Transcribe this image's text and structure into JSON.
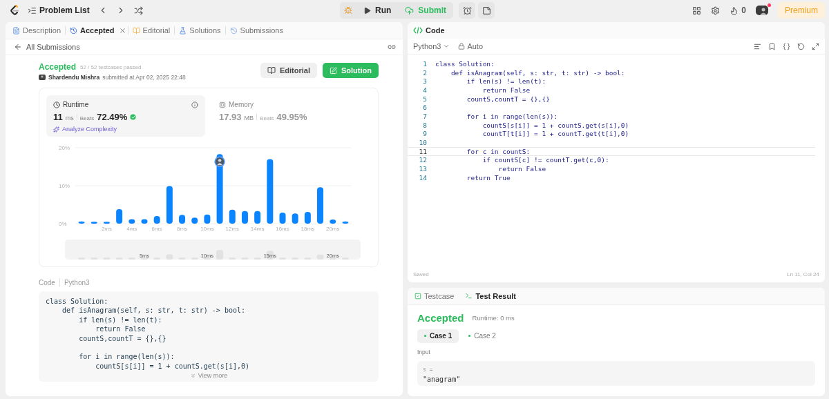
{
  "topbar": {
    "title": "Problem List",
    "run": "Run",
    "submit": "Submit",
    "streak": "0",
    "premium": "Premium",
    "notification": true
  },
  "left_tabs": [
    {
      "label": "Description",
      "selected": false,
      "closable": false
    },
    {
      "label": "Accepted",
      "selected": true,
      "closable": true
    },
    {
      "label": "Editorial",
      "selected": false,
      "closable": false
    },
    {
      "label": "Solutions",
      "selected": false,
      "closable": false
    },
    {
      "label": "Submissions",
      "selected": false,
      "closable": false
    }
  ],
  "back_link": "All Submissions",
  "submission": {
    "status": "Accepted",
    "testcases": "52 / 52 testcases passed",
    "author": "Shardendu Mishra",
    "submitted": "submitted at Apr 02, 2025 22:48",
    "editorial": "Editorial",
    "solution": "Solution"
  },
  "stats": [
    {
      "title": "Runtime",
      "value": "11",
      "unit": "ms",
      "beats_label": "Beats",
      "beats": "72.49%",
      "selected": true
    },
    {
      "title": "Memory",
      "value": "17.93",
      "unit": "MB",
      "beats_label": "Beats",
      "beats": "49.95%",
      "selected": false
    }
  ],
  "analyze": "Analyze Complexity",
  "chart_data": {
    "type": "bar",
    "x": [
      0,
      1,
      2,
      3,
      4,
      5,
      6,
      7,
      8,
      9,
      10,
      11,
      12,
      13,
      14,
      15,
      16,
      17,
      18,
      19,
      20,
      21
    ],
    "series": [
      {
        "color": "#0a84ff",
        "values": [
          0.6,
          0.5,
          0.5,
          3.8,
          1.2,
          1.2,
          2.0,
          9.9,
          2.3,
          1.6,
          2.4,
          18.3,
          3.7,
          3.3,
          3.3,
          17.0,
          2.9,
          2.7,
          3.1,
          9.6,
          1.1,
          0.6
        ]
      }
    ],
    "xlim": [
      -0.5,
      21.5
    ],
    "ylim": [
      0,
      20
    ],
    "yticks": [
      {
        "value": 0,
        "label": "0%"
      },
      {
        "value": 10,
        "label": "10%"
      },
      {
        "value": 20,
        "label": "20%"
      }
    ],
    "xticks": [
      {
        "value": 2,
        "label": "2ms"
      },
      {
        "value": 4,
        "label": "4ms"
      },
      {
        "value": 6,
        "label": "6ms"
      },
      {
        "value": 8,
        "label": "8ms"
      },
      {
        "value": 10,
        "label": "10ms"
      },
      {
        "value": 12,
        "label": "12ms"
      },
      {
        "value": 14,
        "label": "14ms"
      },
      {
        "value": 16,
        "label": "16ms"
      },
      {
        "value": 18,
        "label": "18ms"
      },
      {
        "value": 20,
        "label": "20ms"
      }
    ]
  },
  "navigator_labels": [
    "5ms",
    "10ms",
    "15ms",
    "20ms"
  ],
  "code_preview": {
    "label": "Code",
    "language": "Python3",
    "text": "class Solution:\n    def isAnagram(self, s: str, t: str) -> bool:\n        if len(s) != len(t):\n            return False\n        countS,countT = {},{}\n\n        for i in range(len(s)):\n            countS[s[i]] = 1 + countS.get(s[i],0)",
    "view_more": "View more"
  },
  "editor": {
    "title": "Code",
    "language": "Python3",
    "mode": "Auto",
    "lines": [
      {
        "n": "1",
        "text": "class Solution:",
        "current": false
      },
      {
        "n": "2",
        "text": "    def isAnagram(self, s: str, t: str) -> bool:",
        "current": false
      },
      {
        "n": "3",
        "text": "        if len(s) != len(t):",
        "current": false
      },
      {
        "n": "4",
        "text": "            return False",
        "current": false
      },
      {
        "n": "5",
        "text": "        countS,countT = {},{}",
        "current": false
      },
      {
        "n": "6",
        "current": false
      },
      {
        "n": "7",
        "text": "        for i in range(len(s)):",
        "current": false
      },
      {
        "n": "8",
        "text": "            countS[s[i]] = 1 + countS.get(s[i],0)",
        "current": false
      },
      {
        "n": "9",
        "text": "            countT[t[i]] = 1 + countT.get(t[i],0)",
        "current": false
      },
      {
        "n": "10",
        "current": false
      },
      {
        "n": "11",
        "text": "        for c in countS:",
        "current": true
      },
      {
        "n": "12",
        "text": "            if countS[c] != countT.get(c,0):",
        "current": false
      },
      {
        "n": "13",
        "text": "                return False",
        "current": false
      },
      {
        "n": "14",
        "text": "        return True",
        "current": false
      }
    ],
    "status": "Saved",
    "position": "Ln 11, Col 24"
  },
  "tests": {
    "tabs": [
      {
        "label": "Testcase",
        "selected": false
      },
      {
        "label": "Test Result",
        "selected": true
      }
    ],
    "status": "Accepted",
    "runtime": "Runtime: 0 ms",
    "cases": [
      {
        "label": "Case 1",
        "selected": true
      },
      {
        "label": "Case 2",
        "selected": false
      }
    ],
    "input_label": "Input",
    "input_name": "s =",
    "input_value": "\"anagram\""
  }
}
